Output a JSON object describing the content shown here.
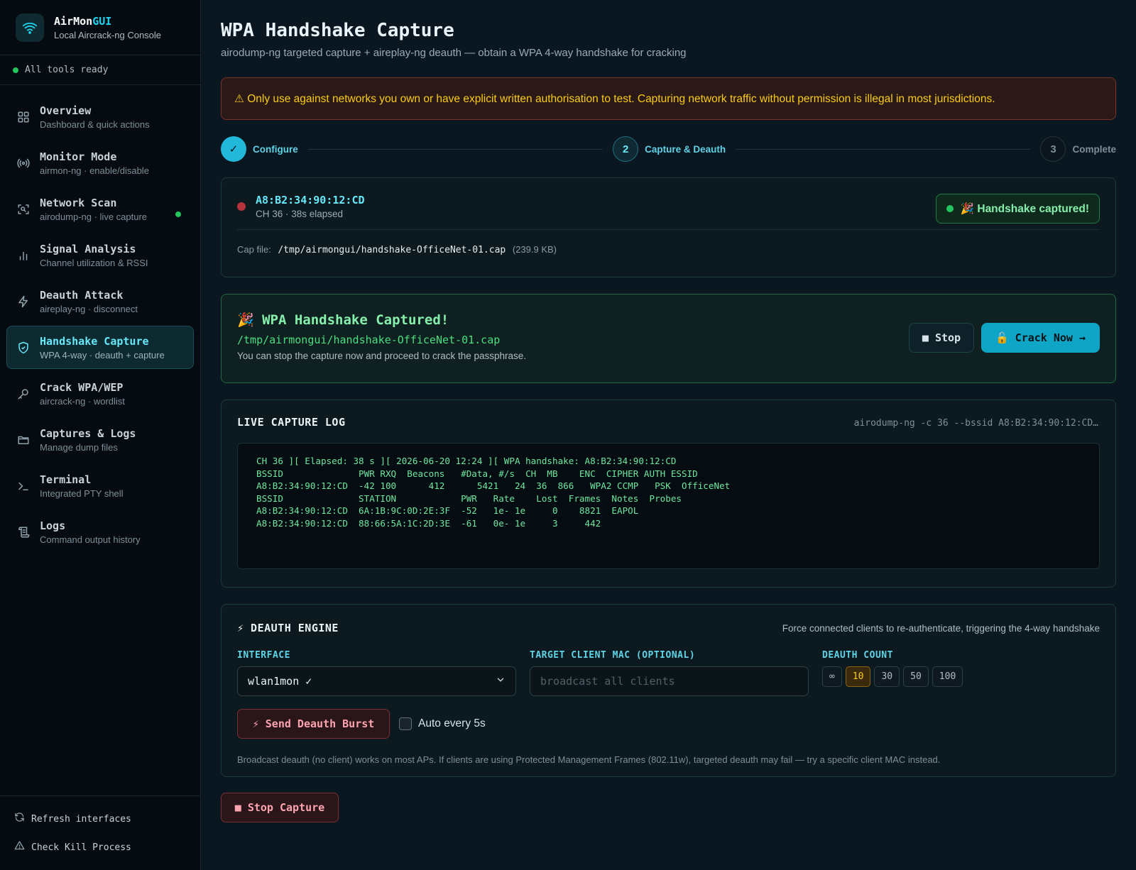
{
  "brand": {
    "title_main": "AirMon",
    "title_accent": "GUI",
    "subtitle": "Local Aircrack-ng Console"
  },
  "status": {
    "text": "All tools ready",
    "color": "#22c55e"
  },
  "sidebar": {
    "items": [
      {
        "label": "Overview",
        "sub": "Dashboard & quick actions",
        "icon": "grid-icon"
      },
      {
        "label": "Monitor Mode",
        "sub": "airmon-ng · enable/disable",
        "icon": "antenna-icon"
      },
      {
        "label": "Network Scan",
        "sub": "airodump-ng · live capture",
        "icon": "scan-icon",
        "live": true
      },
      {
        "label": "Signal Analysis",
        "sub": "Channel utilization & RSSI",
        "icon": "bar-chart-icon"
      },
      {
        "label": "Deauth Attack",
        "sub": "aireplay-ng · disconnect",
        "icon": "lightning-icon"
      },
      {
        "label": "Handshake Capture",
        "sub": "WPA 4-way · deauth + capture",
        "icon": "shield-icon",
        "active": true
      },
      {
        "label": "Crack WPA/WEP",
        "sub": "aircrack-ng · wordlist",
        "icon": "key-icon"
      },
      {
        "label": "Captures & Logs",
        "sub": "Manage dump files",
        "icon": "folder-icon"
      },
      {
        "label": "Terminal",
        "sub": "Integrated PTY shell",
        "icon": "terminal-icon"
      },
      {
        "label": "Logs",
        "sub": "Command output history",
        "icon": "scroll-icon"
      }
    ],
    "bottom": {
      "refresh": "Refresh interfaces",
      "kill": "Check Kill Process"
    }
  },
  "header": {
    "title": "WPA Handshake Capture",
    "subtitle": "airodump-ng targeted capture + aireplay-ng deauth — obtain a WPA 4-way handshake for cracking"
  },
  "warning": "⚠ Only use against networks you own or have explicit written authorisation to test. Capturing network traffic without permission is illegal in most jurisdictions.",
  "stepper": {
    "steps": [
      {
        "num": "✓",
        "label": "Configure",
        "state": "done"
      },
      {
        "num": "2",
        "label": "Capture & Deauth",
        "state": "current"
      },
      {
        "num": "3",
        "label": "Complete",
        "state": "pending"
      }
    ]
  },
  "target": {
    "bssid": "A8:B2:34:90:12:CD",
    "meta": "CH 36   · 38s elapsed",
    "badge": "🎉 Handshake captured!",
    "cap_label": "Cap file:",
    "cap_path": "/tmp/airmongui/handshake-OfficeNet-01.cap",
    "cap_size": "(239.9 KB)"
  },
  "success": {
    "title": "🎉 WPA Handshake Captured!",
    "path": "/tmp/airmongui/handshake-OfficeNet-01.cap",
    "note": "You can stop the capture now and proceed to crack the passphrase.",
    "stop_label": "■ Stop",
    "crack_label": "🔓 Crack Now →"
  },
  "log": {
    "title": "LIVE CAPTURE LOG",
    "command": "airodump-ng -c 36 --bssid A8:B2:34:90:12:CD…",
    "lines": [
      "CH 36 ][ Elapsed: 38 s ][ 2026-06-20 12:24 ][ WPA handshake: A8:B2:34:90:12:CD",
      "",
      "BSSID              PWR RXQ  Beacons   #Data, #/s  CH  MB    ENC  CIPHER AUTH ESSID",
      "A8:B2:34:90:12:CD  -42 100      412      5421   24  36  866   WPA2 CCMP   PSK  OfficeNet",
      "",
      "BSSID              STATION            PWR   Rate    Lost  Frames  Notes  Probes",
      "A8:B2:34:90:12:CD  6A:1B:9C:0D:2E:3F  -52   1e- 1e     0    8821  EAPOL",
      "A8:B2:34:90:12:CD  88:66:5A:1C:2D:3E  -61   0e- 1e     3     442"
    ]
  },
  "deauth": {
    "title": "⚡ DEAUTH ENGINE",
    "hint": "Force connected clients to re-authenticate, triggering the 4-way handshake",
    "interface_label": "INTERFACE",
    "interface_value": "wlan1mon ✓",
    "client_label": "TARGET CLIENT MAC (OPTIONAL)",
    "client_placeholder": "broadcast all clients",
    "count_label": "DEAUTH COUNT",
    "counts": [
      "∞",
      "10",
      "30",
      "50",
      "100"
    ],
    "selected_count": "10",
    "burst_label": "⚡ Send Deauth Burst",
    "auto_label": "Auto every 5s",
    "auto_checked": false,
    "footnote": "Broadcast deauth (no client) works on most APs. If clients are using Protected Management Frames (802.11w), targeted deauth may fail — try a specific client MAC instead."
  },
  "stop_capture_label": "■ Stop Capture"
}
